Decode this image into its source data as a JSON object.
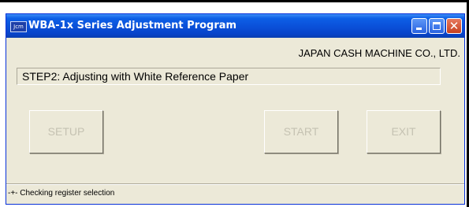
{
  "window": {
    "title": "WBA-1x Series Adjustment Program",
    "icon_label": "Jcm"
  },
  "company": "JAPAN CASH MACHINE CO., LTD.",
  "step": "STEP2: Adjusting with White Reference Paper",
  "buttons": {
    "setup": "SETUP",
    "start": "START",
    "exit": "EXIT"
  },
  "status": "-+- Checking register selection",
  "colors": {
    "titlebar": "#0a4fd8",
    "window_bg": "#ece9d8",
    "disabled_text": "#c5c2b2",
    "close_button": "#c7401f"
  }
}
